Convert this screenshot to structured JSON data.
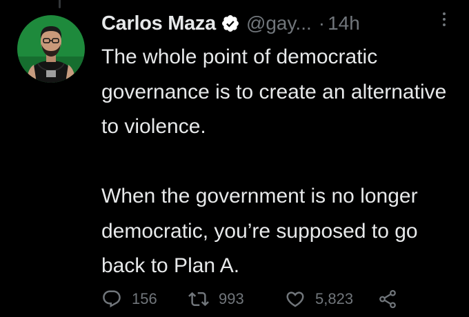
{
  "author": {
    "display_name": "Carlos Maza",
    "handle": "@gay...",
    "timestamp_separator": "·",
    "timestamp": "14h",
    "verified": true,
    "verified_color": "#ffffff"
  },
  "tweet": {
    "paragraphs": [
      "The whole point of democratic governance is to create an alternative to violence.",
      "When the government is no longer democratic, you’re supposed to go back to Plan A."
    ]
  },
  "actions": {
    "replies": "156",
    "retweets": "993",
    "likes": "5,823",
    "icons": [
      "reply-icon",
      "retweet-icon",
      "like-icon",
      "share-icon"
    ]
  },
  "colors": {
    "background": "#000000",
    "primary_text": "#e7e9ea",
    "secondary_text": "#71767b",
    "avatar_bg": "#1e8a3c"
  }
}
